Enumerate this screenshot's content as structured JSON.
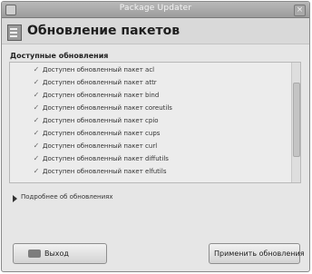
{
  "window": {
    "title": "Package Updater",
    "close_glyph": "×"
  },
  "header": {
    "title": "Обновление пакетов",
    "icon": "package-icon"
  },
  "updates": {
    "section_label": "Доступные обновления",
    "check_glyph": "✓",
    "items": [
      "Доступен обновленный пакет acl",
      "Доступен обновленный пакет attr",
      "Доступен обновленный пакет bind",
      "Доступен обновленный пакет coreutils",
      "Доступен обновленный пакет cpio",
      "Доступен обновленный пакет cups",
      "Доступен обновленный пакет curl",
      "Доступен обновленный пакет diffutils",
      "Доступен обновленный пакет elfutils"
    ]
  },
  "details": {
    "label": "Подробнее об обновлениях"
  },
  "buttons": {
    "cancel_label": "Выход",
    "apply_label": "Применить обновления"
  }
}
